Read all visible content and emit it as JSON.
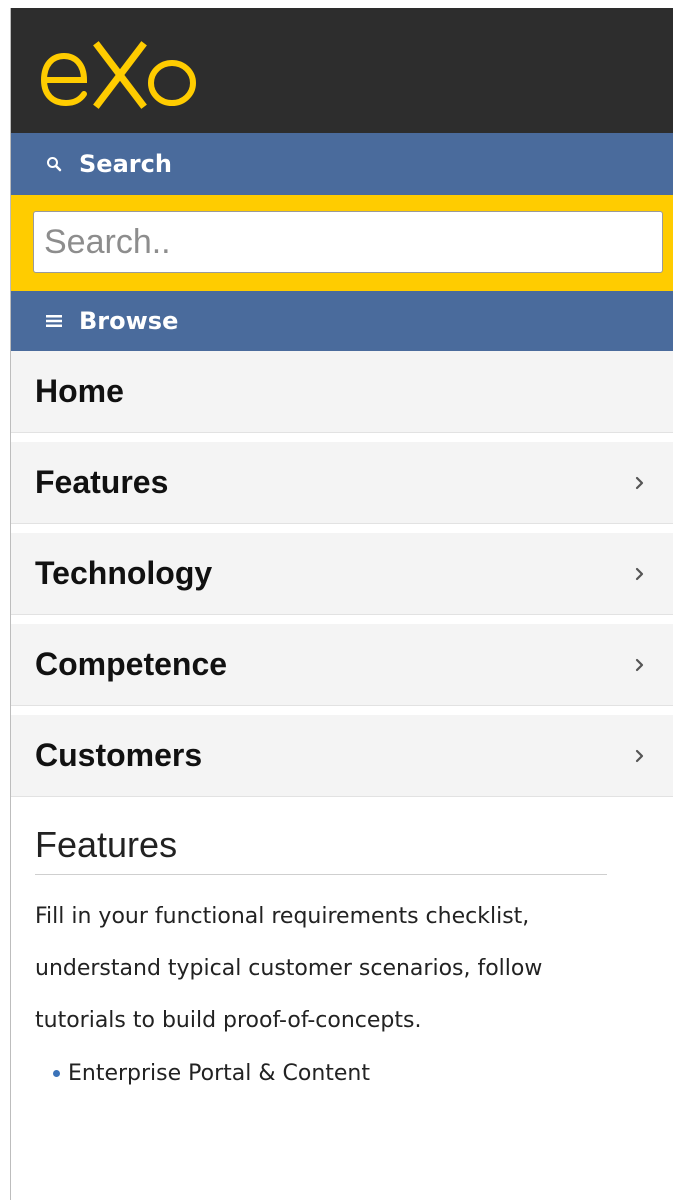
{
  "header": {
    "logo_text": "eXo",
    "brand_color": "#ffcc00",
    "background": "#2d2d2d"
  },
  "search": {
    "section_label": "Search",
    "section_icon": "search-icon",
    "placeholder": "Search..",
    "value": ""
  },
  "browse": {
    "section_label": "Browse",
    "section_icon": "menu-icon"
  },
  "nav": {
    "items": [
      {
        "label": "Home",
        "has_children": false
      },
      {
        "label": "Features",
        "has_children": true
      },
      {
        "label": "Technology",
        "has_children": true
      },
      {
        "label": "Competence",
        "has_children": true
      },
      {
        "label": "Customers",
        "has_children": true
      }
    ]
  },
  "content": {
    "title": "Features",
    "body": "Fill in your functional requirements checklist, understand typical customer scenarios, follow tutorials to build proof-of-concepts.",
    "list": [
      "Enterprise Portal & Content"
    ]
  },
  "colors": {
    "section_bar": "#4a6b9c",
    "search_bg": "#ffcc00",
    "nav_bg": "#f4f4f4",
    "bullet": "#3b73b9"
  }
}
